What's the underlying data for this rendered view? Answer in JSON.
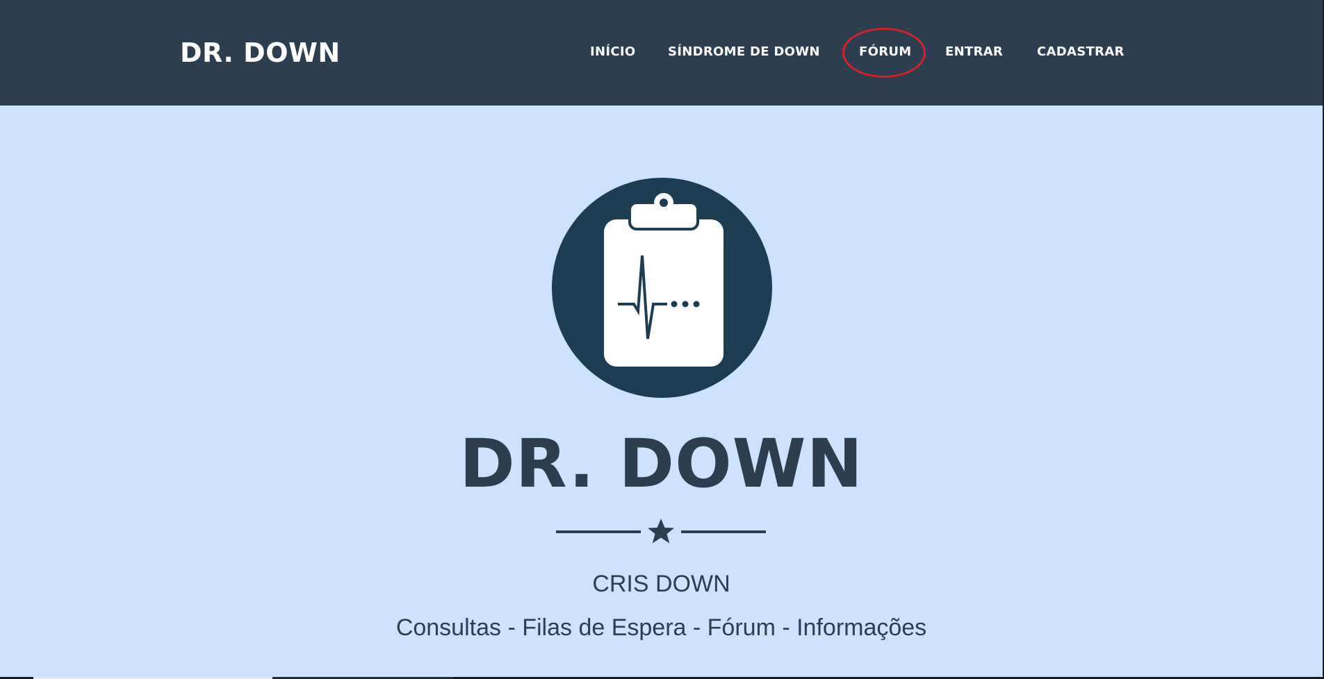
{
  "navbar": {
    "brand": "DR. DOWN",
    "background_color": "#2c3e50",
    "items": [
      {
        "label": "INÍCIO"
      },
      {
        "label": "SÍNDROME DE DOWN"
      },
      {
        "label": "FÓRUM",
        "highlighted": true
      },
      {
        "label": "ENTRAR"
      },
      {
        "label": "CADASTRAR"
      }
    ],
    "highlight_color": "#d9202a"
  },
  "hero": {
    "background_color": "#cce2fe",
    "logo_icon": "clipboard-heartbeat-icon",
    "title": "DR. DOWN",
    "divider_icon": "star-icon",
    "subtitle": "CRIS DOWN",
    "tagline": "Consultas - Filas de Espera - Fórum - Informações",
    "text_color": "#2c3e50"
  }
}
